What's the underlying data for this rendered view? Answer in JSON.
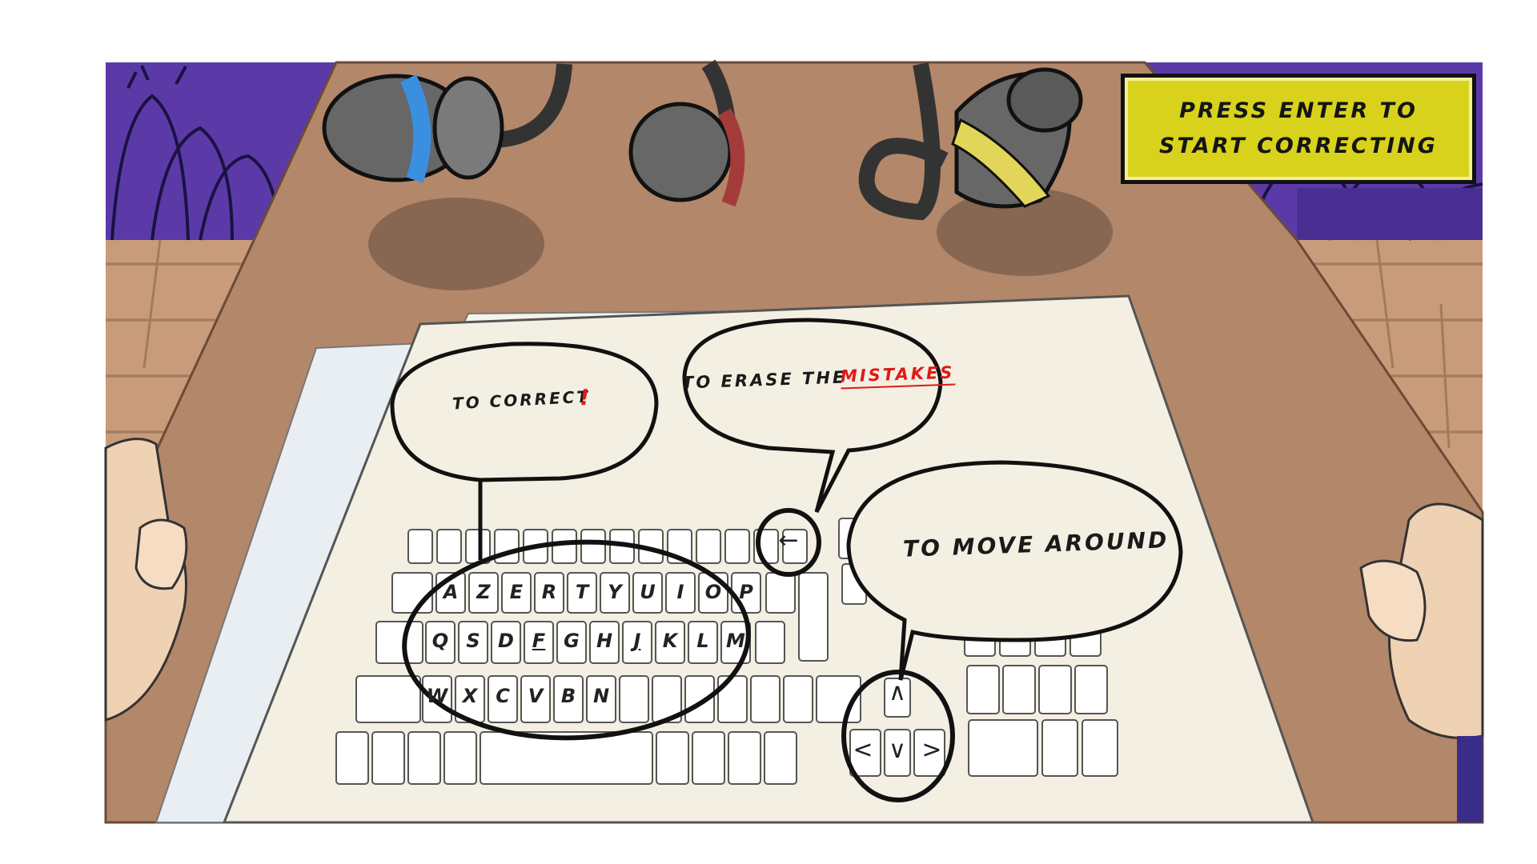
{
  "prompt": {
    "text": "PRESS ENTER TO START CORRECTING"
  },
  "bubbles": {
    "correct": {
      "text": "TO CORRECT",
      "mark": "!"
    },
    "erase": {
      "text": "TO ERASE THE",
      "highlight": "MISTAKES"
    },
    "move": {
      "text": "TO MOVE AROUND"
    }
  },
  "keyboard": {
    "row1": [
      "A",
      "Z",
      "E",
      "R",
      "T",
      "Y",
      "U",
      "I",
      "O",
      "P"
    ],
    "row2": [
      "Q",
      "S",
      "D",
      "F",
      "G",
      "H",
      "J",
      "K",
      "L",
      "M"
    ],
    "row3": [
      "W",
      "X",
      "C",
      "V",
      "B",
      "N"
    ],
    "backspace_glyph": "←",
    "arrow_up": "∧",
    "arrow_left": "<",
    "arrow_down": "∨",
    "arrow_right": ">"
  },
  "colors": {
    "crowd": "#5b3aa8",
    "table": "#b3876a",
    "floor": "#c89b7b",
    "paper": "#f3efe2",
    "prompt_bg": "#d8d21c",
    "accent_red": "#e01818"
  }
}
